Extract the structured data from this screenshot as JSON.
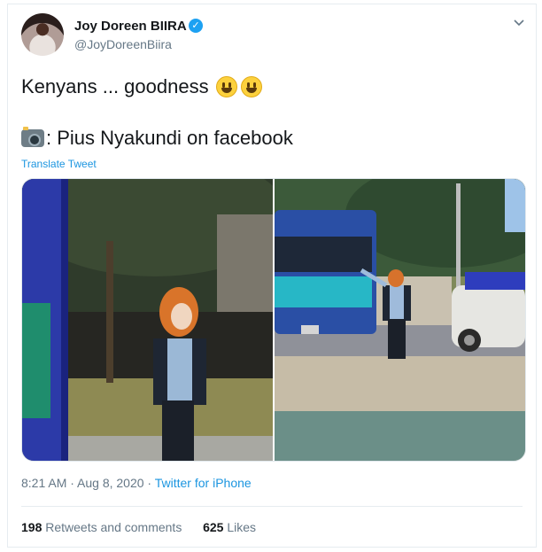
{
  "author": {
    "display_name": "Joy Doreen BIIRA",
    "handle": "@JoyDoreenBiira",
    "verified_icon": "verified-badge-icon"
  },
  "tweet": {
    "line1": "Kenyans ... goodness",
    "line2": ": Pius Nyakundi on facebook",
    "translate_label": "Translate Tweet"
  },
  "meta": {
    "time": "8:21 AM · Aug 8, 2020 · ",
    "source": "Twitter for iPhone"
  },
  "stats": {
    "retweets_count": "198",
    "retweets_label": "Retweets and comments",
    "likes_count": "625",
    "likes_label": "Likes"
  },
  "colors": {
    "link": "#1b95e0",
    "verified": "#1da1f2",
    "muted": "#657786"
  }
}
